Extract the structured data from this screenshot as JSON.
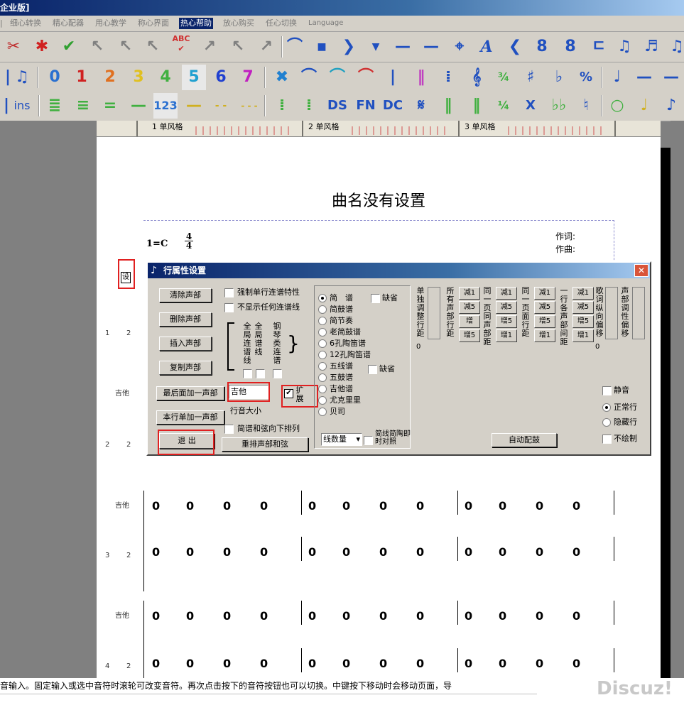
{
  "window": {
    "title": "企业版]"
  },
  "menu": [
    {
      "label": "细心转换"
    },
    {
      "label": "精心配器"
    },
    {
      "label": "用心教学"
    },
    {
      "label": "称心界面"
    },
    {
      "label": "热心帮助",
      "active": true
    },
    {
      "label": "放心购买"
    },
    {
      "label": "任心切换"
    },
    {
      "label": "Language"
    }
  ],
  "toolbar1": {
    "abc_label": "ABC"
  },
  "toolbar3": {
    "ins_label": "ins",
    "num_label": "123",
    "ds": "DS",
    "fn": "FN",
    "dc": "DC",
    "x": "X"
  },
  "toolbar2": {
    "digits": [
      "0",
      "1",
      "2",
      "3",
      "4",
      "5",
      "6",
      "7"
    ],
    "percent": "%"
  },
  "ruler": {
    "labels": [
      "1 单风格",
      "2 单风格",
      "3 单风格"
    ]
  },
  "score": {
    "title": "曲名没有设置",
    "key": "1=C",
    "time_top": "4",
    "time_bottom": "4",
    "lyricist_label": "作词:",
    "composer_label": "作曲:",
    "set_button": "设",
    "instrument": "吉他",
    "row_numbers": [
      {
        "a": "1",
        "b": "2"
      },
      {
        "a": "2",
        "b": "2"
      },
      {
        "a": "3",
        "b": "2"
      },
      {
        "a": "4",
        "b": "2"
      }
    ],
    "note": "0"
  },
  "dialog": {
    "title": "行属性设置",
    "buttons": {
      "clear": "清除声部",
      "delete": "删除声部",
      "insert": "插入声部",
      "copy": "复制声部",
      "add_last": "最后面加一声部",
      "add_row": "本行单加一声部",
      "exit": "退  出",
      "rearrange": "重排声部和弦",
      "auto_drum": "自动配鼓"
    },
    "checks": {
      "force_single": "强制单行连谱特性",
      "hide_lines": "不显示任何连谱线",
      "jianpu_chord": "简谱和弦向下排列",
      "default1": "缺省",
      "default2": "缺省",
      "sync": "简线简陶即时对照"
    },
    "col_labels": {
      "full1": "全局连谱线",
      "full2": "全局谱线",
      "piano": "钢琴类连谱"
    },
    "instrument_value": "吉他",
    "expand_label": "扩展",
    "row_size": "行音大小",
    "line_count": "线数量",
    "notations": [
      "简　谱",
      "简鼓谱",
      "简节奏",
      "老简鼓谱",
      "6孔陶笛谱",
      "12孔陶笛谱",
      "五线谱",
      "五鼓谱",
      "吉他谱",
      "尤克里里",
      "贝司"
    ],
    "v_labels": {
      "solo": "单独调整行距",
      "all_parts": "所有声部行距",
      "same_page_parts": "同一页同声部距",
      "same_page_rows": "同一页面行距",
      "one_row_parts": "一行各声部间距",
      "lyric": "歌词纵向偏移",
      "part_color": "声部调性偏移"
    },
    "spin_buttons": {
      "dec1": "减1",
      "dec5": "减5",
      "inc": "增",
      "inc5": "增5",
      "inc1": "增1"
    },
    "zero": "0",
    "modes": {
      "mute": "静音",
      "normal": "正常行",
      "hidden": "隐藏行",
      "nodraw": "不绘制"
    }
  },
  "status": {
    "text": "音输入。固定输入或选中音符时滚轮可改变音符。再次点击按下的音符按钮也可以切换。中键按下移动时会移动页面，导",
    "watermark": "Discuz!"
  }
}
